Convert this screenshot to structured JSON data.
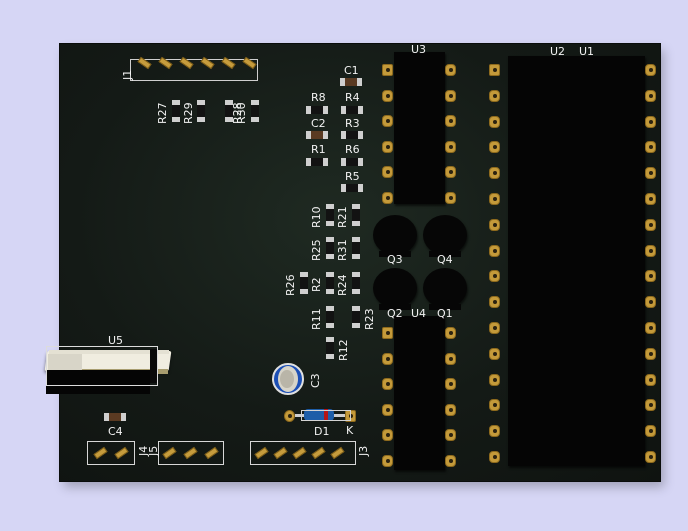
{
  "board": {
    "components": {
      "J1": "J1",
      "U3": "U3",
      "U2": "U2",
      "U1": "U1",
      "C1": "C1",
      "R8": "R8",
      "R4": "R4",
      "C2": "C2",
      "R3": "R3",
      "R1": "R1",
      "R6": "R6",
      "R5": "R5",
      "R27": "R27",
      "R29": "R29",
      "R28": "R28",
      "R30": "R30",
      "R10": "R10",
      "R21": "R21",
      "R25": "R25",
      "R31": "R31",
      "R26": "R26",
      "R2": "R2",
      "R24": "R24",
      "R11": "R11",
      "R23": "R23",
      "R12": "R12",
      "Q3": "Q3",
      "Q4": "Q4",
      "Q2": "Q2",
      "U4": "U4",
      "Q1": "Q1",
      "U5": "U5",
      "C3": "C3",
      "C4": "C4",
      "D1": "D1",
      "K": "K",
      "J4": "J4",
      "J5": "J5",
      "J3": "J3"
    },
    "colors": {
      "pcb": "#141a16",
      "silkscreen": "#f2f2f2",
      "pad": "#c49a3a",
      "ic_body": "#050505",
      "background": "#d6d6f5"
    }
  }
}
